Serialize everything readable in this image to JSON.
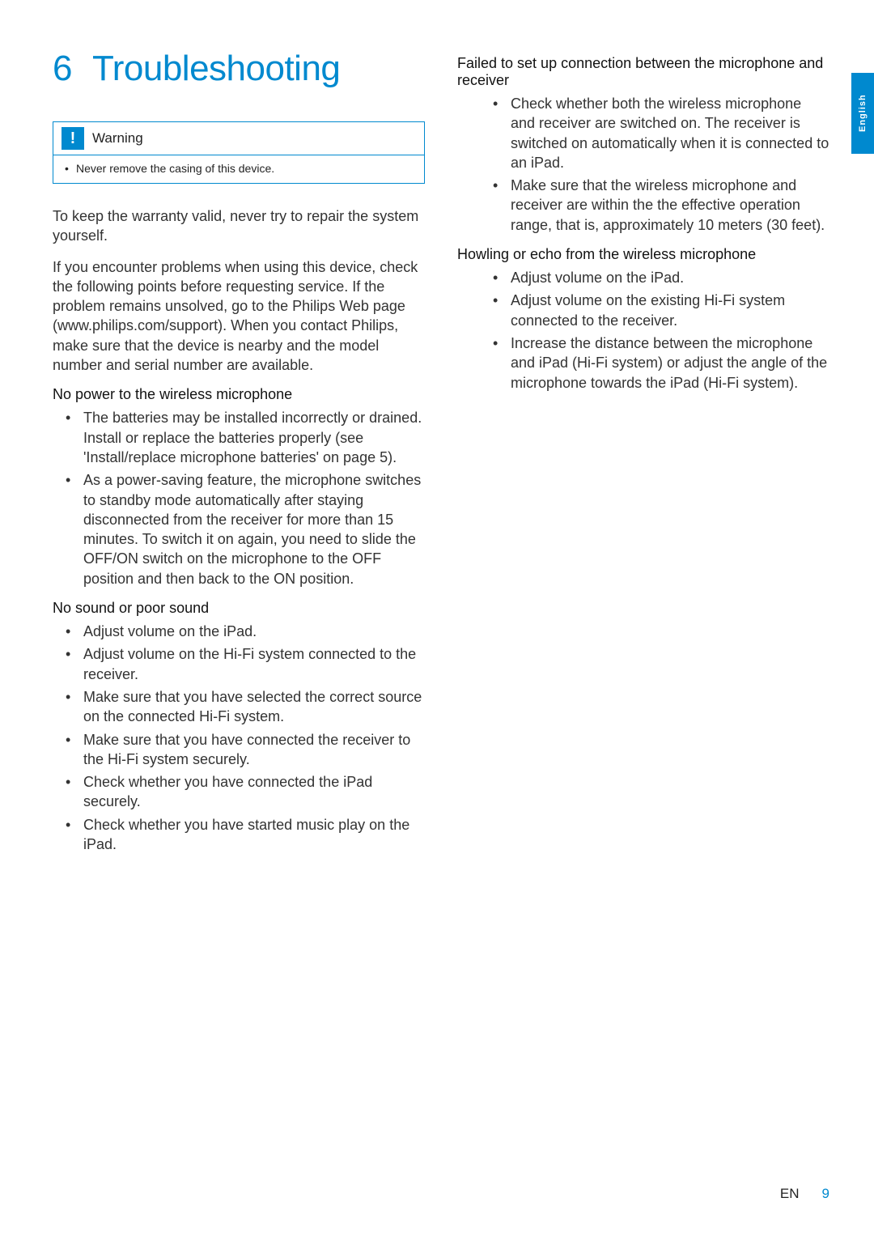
{
  "chapter": {
    "number": "6",
    "title": "Troubleshooting"
  },
  "warning": {
    "label": "Warning",
    "item": "Never remove the casing of this device."
  },
  "intro": {
    "p1": "To keep the warranty valid, never try to repair the system yourself.",
    "p2": "If you encounter problems when using this device, check the following points before requesting service. If the problem remains unsolved, go to the Philips Web page (www.philips.com/support). When you contact Philips, make sure that the device is nearby and the model number and serial number are available."
  },
  "sections": {
    "nopower": {
      "head": "No power to the wireless microphone",
      "items": [
        "The batteries may be installed incorrectly or drained. Install or replace the batteries properly (see 'Install/replace microphone batteries' on page 5).",
        "As a power-saving feature, the microphone switches to standby mode automatically after staying disconnected from the receiver for more than 15 minutes. To switch it on again, you need to slide the OFF/ON switch on the microphone to the OFF position and then back to the ON position."
      ]
    },
    "nosound": {
      "head": "No sound or poor sound",
      "items": [
        "Adjust volume on the iPad.",
        "Adjust volume on the Hi-Fi system connected to the receiver.",
        "Make sure that you have selected the correct source on the connected Hi-Fi system.",
        "Make sure that you have connected the receiver to the Hi-Fi system securely.",
        "Check whether you have connected the iPad securely.",
        "Check whether you have started music play on the iPad."
      ]
    },
    "failedconn": {
      "head": "Failed to set up connection between the microphone and receiver",
      "items": [
        "Check whether both the wireless microphone and receiver are switched on. The receiver is switched on automatically when it is connected to an iPad.",
        "Make sure that the wireless microphone and receiver are within the the effective operation range, that is, approximately 10 meters (30 feet)."
      ]
    },
    "howling": {
      "head": "Howling or echo from the wireless microphone",
      "items": [
        "Adjust volume on the iPad.",
        "Adjust volume on the existing Hi-Fi system connected to the receiver.",
        "Increase the distance between the microphone and iPad (Hi-Fi system) or adjust the angle of the microphone towards the iPad (Hi-Fi system)."
      ]
    }
  },
  "footer": {
    "lang": "EN",
    "page": "9"
  },
  "side_tab": "English"
}
